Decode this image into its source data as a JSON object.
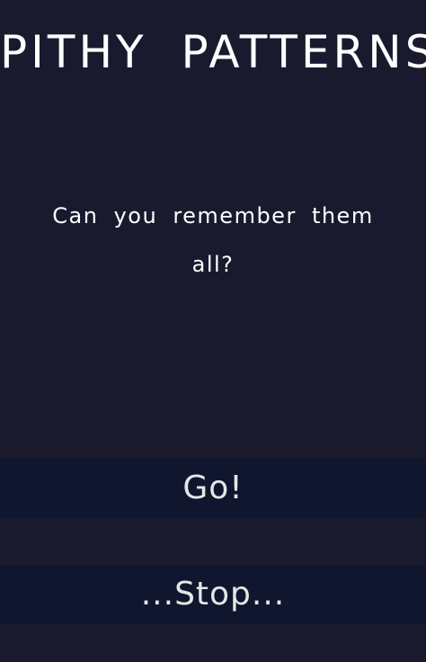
{
  "game": {
    "title": "PITHY PATTERNS",
    "subtitle": "Can you remember them all?"
  },
  "buttons": {
    "go_label": "Go!",
    "stop_label": "...Stop..."
  },
  "colors": {
    "background": "#191a2e",
    "button_background": "#11162f",
    "text": "#ffffff"
  }
}
